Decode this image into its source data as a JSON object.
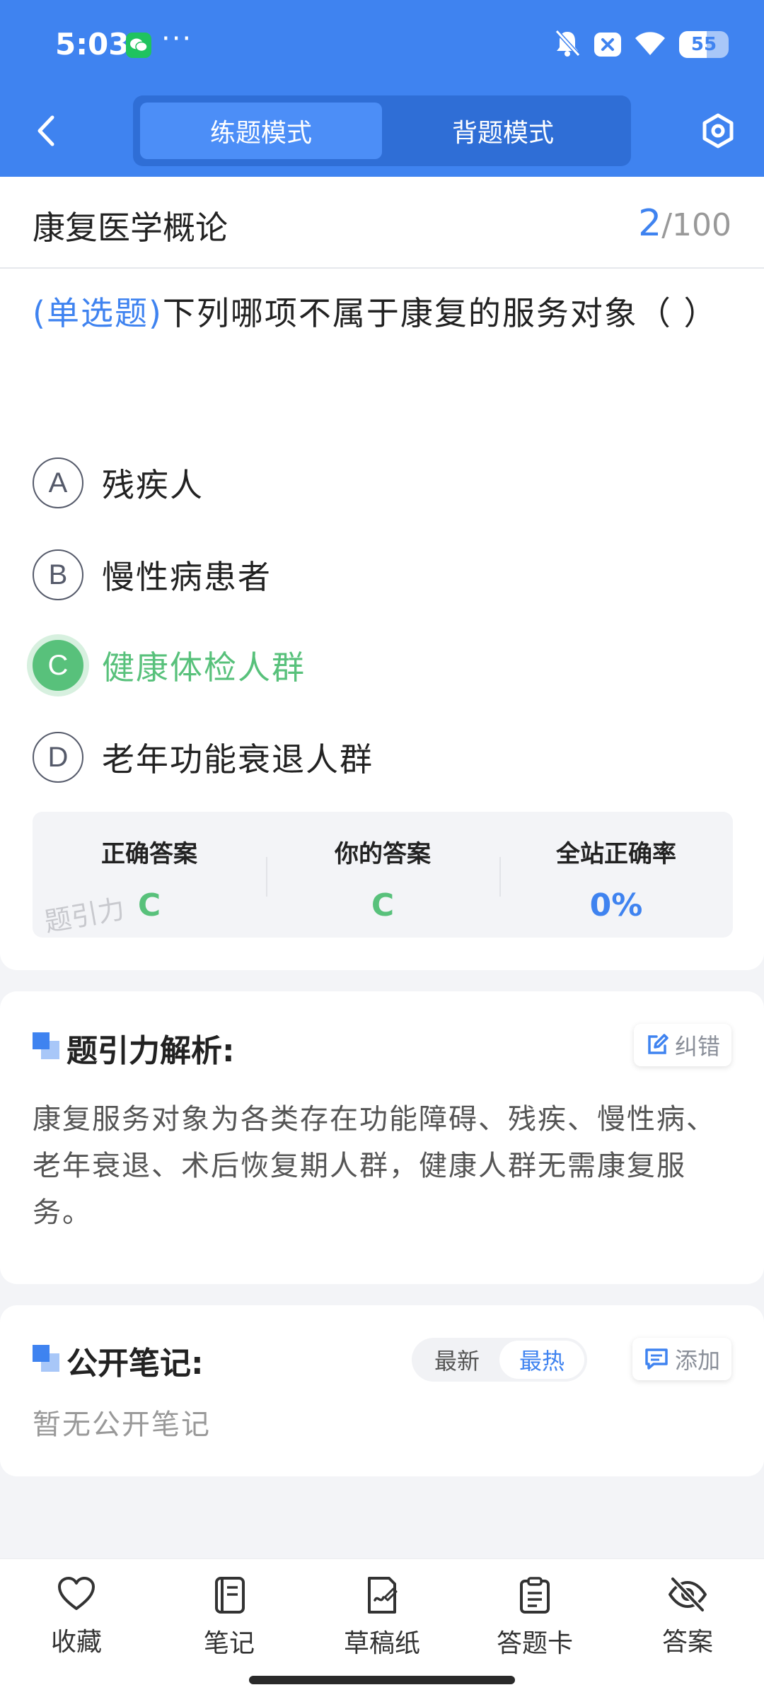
{
  "status_bar": {
    "time": "5:03",
    "battery": "55",
    "battery_level": 0.55
  },
  "nav": {
    "tabs": [
      {
        "label": "练题模式",
        "active": true
      },
      {
        "label": "背题模式",
        "active": false
      }
    ]
  },
  "question": {
    "course": "康复医学概论",
    "current": "2",
    "total": "/100",
    "type": "(单选题)",
    "text": "下列哪项不属于康复的服务对象（ ）",
    "options": [
      {
        "letter": "A",
        "text": "残疾人"
      },
      {
        "letter": "B",
        "text": "慢性病患者"
      },
      {
        "letter": "C",
        "text": "健康体检人群",
        "selected": true
      },
      {
        "letter": "D",
        "text": "老年功能衰退人群"
      }
    ]
  },
  "result": {
    "correct_label": "正确答案",
    "correct_value": "C",
    "yours_label": "你的答案",
    "yours_value": "C",
    "rate_label": "全站正确率",
    "rate_value": "0%",
    "watermark": "题引力"
  },
  "analysis": {
    "title": "题引力解析:",
    "report_label": "纠错",
    "text": "康复服务对象为各类存在功能障碍、残疾、慢性病、老年衰退、术后恢复期人群，健康人群无需康复服务。"
  },
  "notes": {
    "title": "公开笔记:",
    "sort_latest": "最新",
    "sort_hot": "最热",
    "add_label": "添加",
    "empty": "暂无公开笔记"
  },
  "bottom_tabs": [
    {
      "label": "收藏",
      "icon": "heart-icon"
    },
    {
      "label": "笔记",
      "icon": "notebook-icon"
    },
    {
      "label": "草稿纸",
      "icon": "draft-paper-icon"
    },
    {
      "label": "答题卡",
      "icon": "answer-card-icon"
    },
    {
      "label": "答案",
      "icon": "eye-off-icon"
    }
  ],
  "colors": {
    "primary": "#3f83f0",
    "correct": "#58c17b"
  }
}
